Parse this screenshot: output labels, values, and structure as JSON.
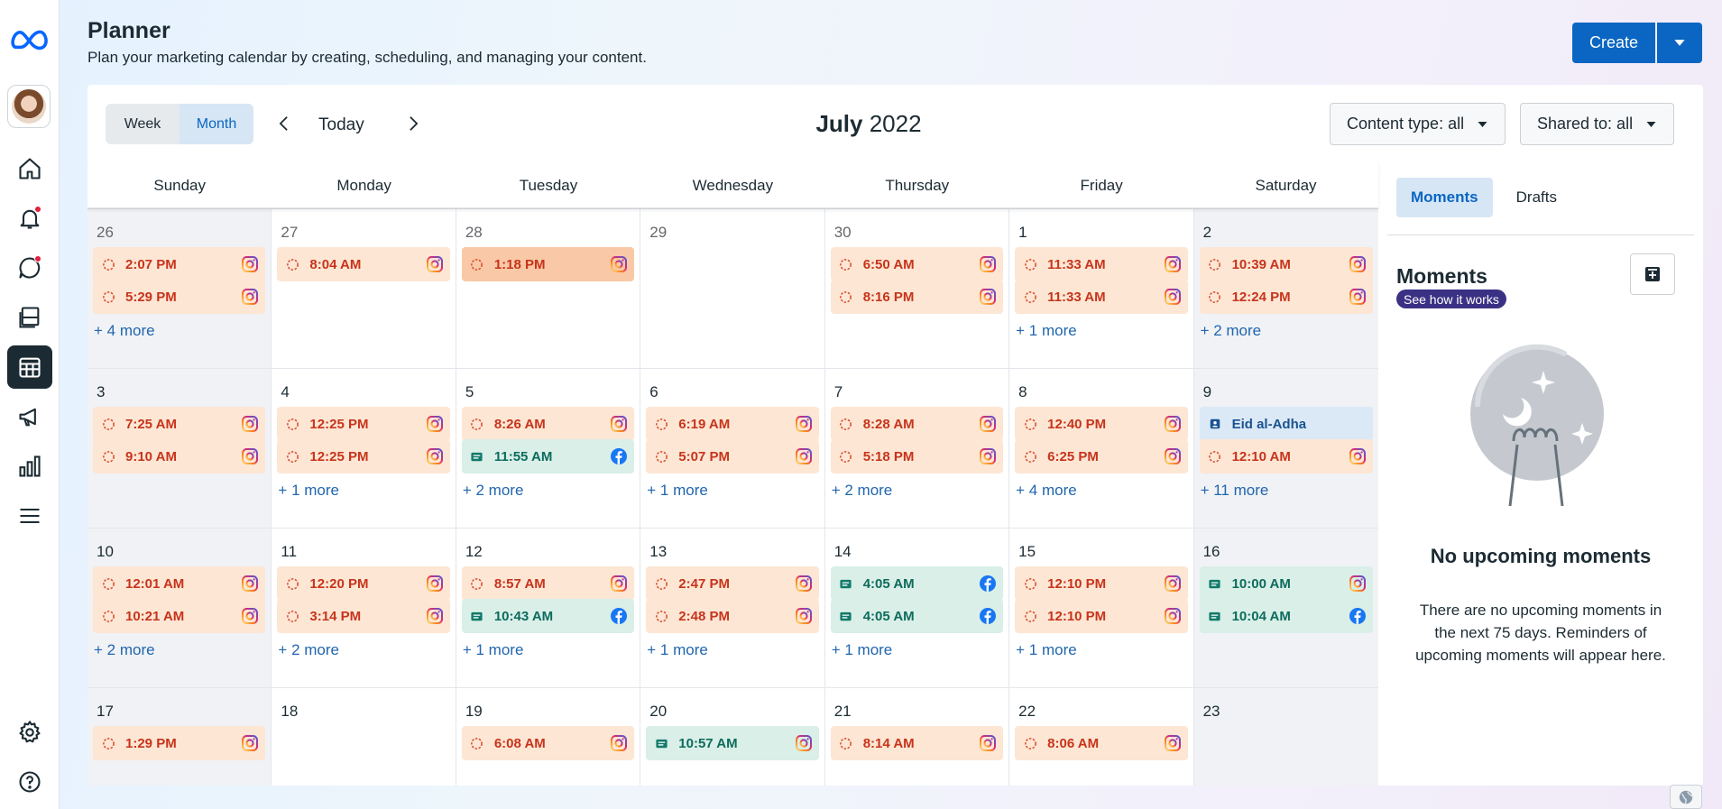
{
  "header": {
    "title": "Planner",
    "subtitle": "Plan your marketing calendar by creating, scheduling, and managing your content.",
    "create_label": "Create"
  },
  "toolbar": {
    "week_label": "Week",
    "month_label": "Month",
    "active_view": "Month",
    "today_label": "Today",
    "month_name": "July",
    "year": "2022",
    "content_type_filter": "Content type: all",
    "shared_to_filter": "Shared to: all"
  },
  "weekdays": [
    "Sunday",
    "Monday",
    "Tuesday",
    "Wednesday",
    "Thursday",
    "Friday",
    "Saturday"
  ],
  "colors": {
    "scheduled_bg": "#fde6d4",
    "scheduled_text": "#c7341b",
    "published_bg": "#d9efe8",
    "published_text": "#0d6b5c",
    "moment_bg": "#dbe9f6",
    "accent": "#0a66c2"
  },
  "weeks": [
    [
      {
        "day": "26",
        "muted": true,
        "shade": true,
        "events": [
          {
            "time": "2:07 PM",
            "status": "scheduled",
            "platform": "instagram"
          },
          {
            "time": "5:29 PM",
            "status": "scheduled",
            "platform": "instagram"
          }
        ],
        "more": "+ 4 more"
      },
      {
        "day": "27",
        "muted": true,
        "events": [
          {
            "time": "8:04 AM",
            "status": "scheduled",
            "platform": "instagram"
          }
        ],
        "more": ""
      },
      {
        "day": "28",
        "muted": true,
        "events": [
          {
            "time": "1:18 PM",
            "status": "selected",
            "platform": "instagram"
          }
        ],
        "more": ""
      },
      {
        "day": "29",
        "muted": true,
        "events": [],
        "more": ""
      },
      {
        "day": "30",
        "muted": true,
        "events": [
          {
            "time": "6:50 AM",
            "status": "scheduled",
            "platform": "instagram"
          },
          {
            "time": "8:16 PM",
            "status": "scheduled",
            "platform": "instagram"
          }
        ],
        "more": ""
      },
      {
        "day": "1",
        "events": [
          {
            "time": "11:33 AM",
            "status": "scheduled",
            "platform": "instagram"
          },
          {
            "time": "11:33 AM",
            "status": "scheduled",
            "platform": "instagram"
          }
        ],
        "more": "+ 1 more"
      },
      {
        "day": "2",
        "shade": true,
        "events": [
          {
            "time": "10:39 AM",
            "status": "scheduled",
            "platform": "instagram"
          },
          {
            "time": "12:24 PM",
            "status": "scheduled",
            "platform": "instagram"
          }
        ],
        "more": "+ 2 more"
      }
    ],
    [
      {
        "day": "3",
        "shade": true,
        "events": [
          {
            "time": "7:25 AM",
            "status": "scheduled",
            "platform": "instagram"
          },
          {
            "time": "9:10 AM",
            "status": "scheduled",
            "platform": "instagram"
          }
        ],
        "more": ""
      },
      {
        "day": "4",
        "events": [
          {
            "time": "12:25 PM",
            "status": "scheduled",
            "platform": "instagram"
          },
          {
            "time": "12:25 PM",
            "status": "scheduled",
            "platform": "instagram"
          }
        ],
        "more": "+ 1 more"
      },
      {
        "day": "5",
        "events": [
          {
            "time": "8:26 AM",
            "status": "scheduled",
            "platform": "instagram"
          },
          {
            "time": "11:55 AM",
            "status": "published",
            "platform": "facebook"
          }
        ],
        "more": "+ 2 more"
      },
      {
        "day": "6",
        "events": [
          {
            "time": "6:19 AM",
            "status": "scheduled",
            "platform": "instagram"
          },
          {
            "time": "5:07 PM",
            "status": "scheduled",
            "platform": "instagram"
          }
        ],
        "more": "+ 1 more"
      },
      {
        "day": "7",
        "events": [
          {
            "time": "8:28 AM",
            "status": "scheduled",
            "platform": "instagram"
          },
          {
            "time": "5:18 PM",
            "status": "scheduled",
            "platform": "instagram"
          }
        ],
        "more": "+ 2 more"
      },
      {
        "day": "8",
        "events": [
          {
            "time": "12:40 PM",
            "status": "scheduled",
            "platform": "instagram"
          },
          {
            "time": "6:25 PM",
            "status": "scheduled",
            "platform": "instagram"
          }
        ],
        "more": "+ 4 more"
      },
      {
        "day": "9",
        "shade": true,
        "events": [
          {
            "time": "Eid al-Adha",
            "status": "moment",
            "platform": ""
          },
          {
            "time": "12:10 AM",
            "status": "scheduled",
            "platform": "instagram"
          }
        ],
        "more": "+ 11 more"
      }
    ],
    [
      {
        "day": "10",
        "shade": true,
        "events": [
          {
            "time": "12:01 AM",
            "status": "scheduled",
            "platform": "instagram"
          },
          {
            "time": "10:21 AM",
            "status": "scheduled",
            "platform": "instagram"
          }
        ],
        "more": "+ 2 more"
      },
      {
        "day": "11",
        "events": [
          {
            "time": "12:20 PM",
            "status": "scheduled",
            "platform": "instagram"
          },
          {
            "time": "3:14 PM",
            "status": "scheduled",
            "platform": "instagram"
          }
        ],
        "more": "+ 2 more"
      },
      {
        "day": "12",
        "events": [
          {
            "time": "8:57 AM",
            "status": "scheduled",
            "platform": "instagram"
          },
          {
            "time": "10:43 AM",
            "status": "published",
            "platform": "facebook"
          }
        ],
        "more": "+ 1 more"
      },
      {
        "day": "13",
        "events": [
          {
            "time": "2:47 PM",
            "status": "scheduled",
            "platform": "instagram"
          },
          {
            "time": "2:48 PM",
            "status": "scheduled",
            "platform": "instagram"
          }
        ],
        "more": "+ 1 more"
      },
      {
        "day": "14",
        "events": [
          {
            "time": "4:05 AM",
            "status": "published",
            "platform": "facebook"
          },
          {
            "time": "4:05 AM",
            "status": "published",
            "platform": "facebook"
          }
        ],
        "more": "+ 1 more"
      },
      {
        "day": "15",
        "events": [
          {
            "time": "12:10 PM",
            "status": "scheduled",
            "platform": "instagram"
          },
          {
            "time": "12:10 PM",
            "status": "scheduled",
            "platform": "instagram"
          }
        ],
        "more": "+ 1 more"
      },
      {
        "day": "16",
        "shade": true,
        "events": [
          {
            "time": "10:00 AM",
            "status": "published",
            "platform": "instagram"
          },
          {
            "time": "10:04 AM",
            "status": "published",
            "platform": "facebook"
          }
        ],
        "more": ""
      }
    ],
    [
      {
        "day": "17",
        "shade": true,
        "events": [
          {
            "time": "1:29 PM",
            "status": "scheduled",
            "platform": "instagram"
          }
        ],
        "more": ""
      },
      {
        "day": "18",
        "events": [],
        "more": ""
      },
      {
        "day": "19",
        "events": [
          {
            "time": "6:08 AM",
            "status": "scheduled",
            "platform": "instagram"
          }
        ],
        "more": ""
      },
      {
        "day": "20",
        "events": [
          {
            "time": "10:57 AM",
            "status": "published",
            "platform": "instagram"
          }
        ],
        "more": ""
      },
      {
        "day": "21",
        "events": [
          {
            "time": "8:14 AM",
            "status": "scheduled",
            "platform": "instagram"
          }
        ],
        "more": ""
      },
      {
        "day": "22",
        "events": [
          {
            "time": "8:06 AM",
            "status": "scheduled",
            "platform": "instagram"
          }
        ],
        "more": ""
      },
      {
        "day": "23",
        "shade": true,
        "events": [],
        "more": ""
      }
    ]
  ],
  "side_panel": {
    "tabs": [
      "Moments",
      "Drafts"
    ],
    "active_tab": "Moments",
    "moments_title": "Moments",
    "how_it_works": "See how it works",
    "empty_title": "No upcoming moments",
    "empty_text": "There are no upcoming moments in the next 75 days. Reminders of upcoming moments will appear here."
  },
  "rail_icons": [
    "meta-logo-icon",
    "avatar",
    "home-icon",
    "notifications-icon",
    "inbox-icon",
    "content-icon",
    "planner-icon",
    "ads-icon",
    "insights-icon",
    "menu-icon",
    "settings-icon",
    "help-icon"
  ]
}
